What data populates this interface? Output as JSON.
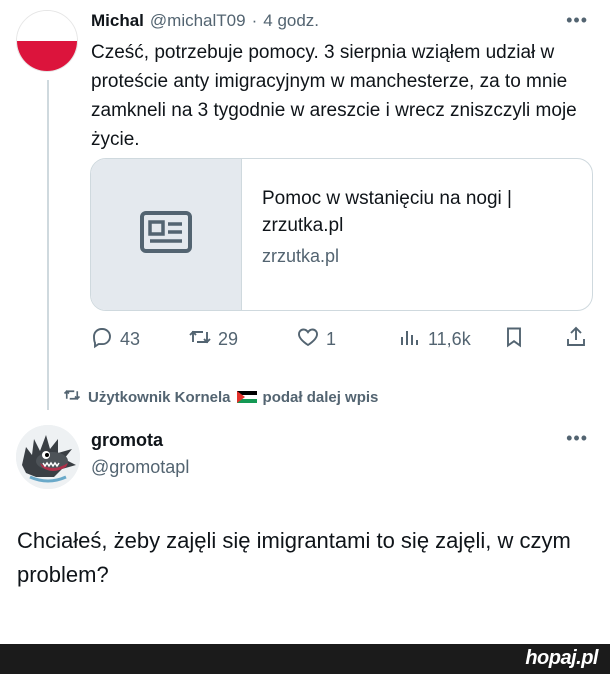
{
  "tweet1": {
    "display_name": "Michal",
    "handle": "@michalT09",
    "separator": "·",
    "time": "4 godz.",
    "text": "Cześć, potrzebuje pomocy. 3 sierpnia wziąłem udział w proteście anty imigracyjnym w manchesterze, za to mnie zamkneli na 3 tygodnie w areszcie i wrecz zniszczyli moje życie.",
    "more_label": "•••",
    "card": {
      "title": "Pomoc w wstanięciu na nogi | zrzutka.pl",
      "domain": "zrzutka.pl",
      "thumb_icon": "article-icon"
    },
    "actions": {
      "replies": "43",
      "retweets": "29",
      "likes": "1",
      "views": "11,6k"
    },
    "avatar_colors": [
      "#ffffff",
      "#dc143c"
    ]
  },
  "retweet_note": {
    "user": "Użytkownik Kornela",
    "suffix": "podał dalej wpis"
  },
  "tweet2": {
    "display_name": "gromota",
    "handle": "@gromotapl",
    "more_label": "•••",
    "text": "Chciałeś, żeby zajęli się imigrantami to się zajęli, w czym problem?"
  },
  "watermark": {
    "brand": "hopaj.pl"
  },
  "colors": {
    "text_primary": "#0f1419",
    "text_secondary": "#536471",
    "border": "#cfd9de",
    "bottom_bar": "#1b1b1b"
  }
}
